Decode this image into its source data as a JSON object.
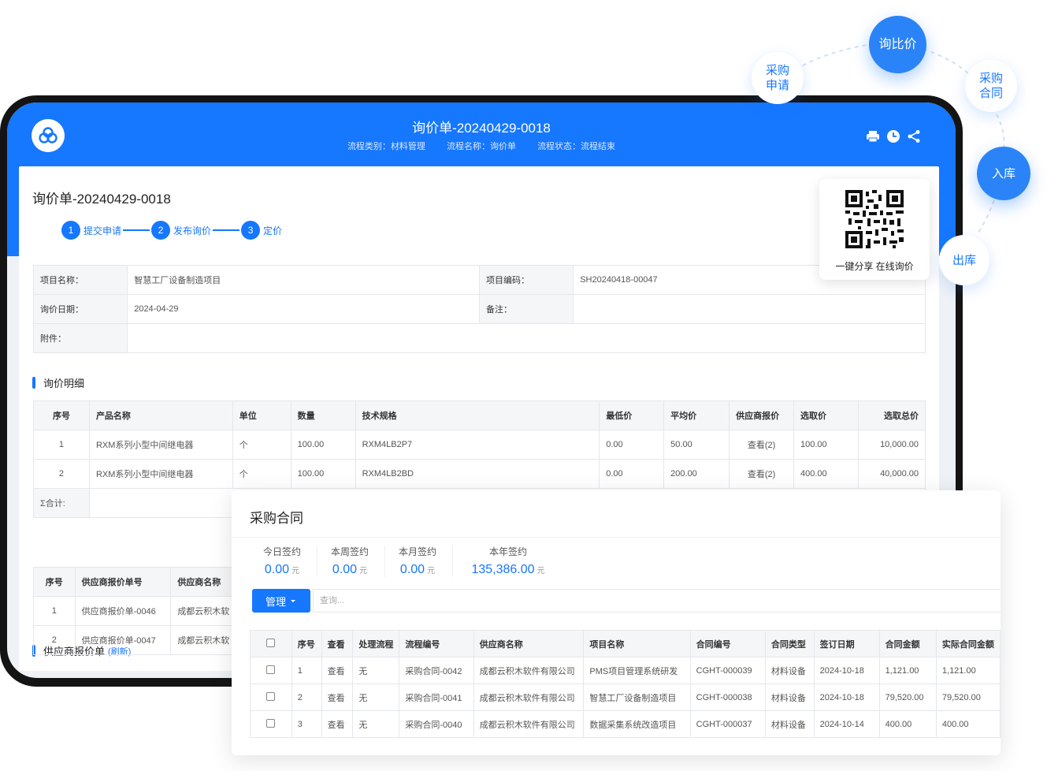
{
  "orbit": {
    "purchase_request": [
      "采购",
      "申请"
    ],
    "inquiry_compare": "询比价",
    "purchase_contract": [
      "采购",
      "合同"
    ],
    "stock_in": "入库",
    "stock_out": "出库"
  },
  "header": {
    "title": "询价单-20240429-0018",
    "meta": {
      "process_type": "流程类别：材料管理",
      "process_name": "流程名称：询价单",
      "process_status": "流程状态：流程结束"
    },
    "icons": [
      "print-icon",
      "clock-icon",
      "share-icon"
    ]
  },
  "document": {
    "title": "询价单-20240429-0018",
    "steps": [
      {
        "num": "1",
        "label": "提交申请"
      },
      {
        "num": "2",
        "label": "发布询价"
      },
      {
        "num": "3",
        "label": "定价"
      }
    ],
    "info": {
      "project_name_label": "项目名称：",
      "project_name_value": "智慧工厂设备制造项目",
      "project_code_label": "项目编码：",
      "project_code_value": "SH20240418-00047",
      "inquiry_date_label": "询价日期：",
      "inquiry_date_value": "2024-04-29",
      "remark_label": "备注：",
      "remark_value": "",
      "attachment_label": "附件：",
      "attachment_value": ""
    }
  },
  "qr": {
    "caption": "一键分享 在线询价"
  },
  "detail": {
    "title": "询价明细",
    "headers": [
      "序号",
      "产品名称",
      "单位",
      "数量",
      "技术规格",
      "最低价",
      "平均价",
      "供应商报价",
      "选取价",
      "选取总价"
    ],
    "rows": [
      [
        "1",
        "RXM系列小型中间继电器",
        "个",
        "100.00",
        "RXM4LB2P7",
        "0.00",
        "50.00",
        "查看(2)",
        "100.00",
        "10,000.00"
      ],
      [
        "2",
        "RXM系列小型中间继电器",
        "个",
        "100.00",
        "RXM4LB2BD",
        "0.00",
        "200.00",
        "查看(2)",
        "400.00",
        "40,000.00"
      ]
    ],
    "total_label": "Σ合计:"
  },
  "quotes": {
    "title": "供应商报价单",
    "refresh": "(刷新)",
    "headers": [
      "序号",
      "供应商报价单号",
      "供应商名称"
    ],
    "rows": [
      [
        "1",
        "供应商报价单-0046",
        "成都云积木软"
      ],
      [
        "2",
        "供应商报价单-0047",
        "成都云积木软"
      ]
    ]
  },
  "contract_panel": {
    "title": "采购合同",
    "stats": [
      {
        "label": "今日签约",
        "value": "0.00",
        "unit": "元"
      },
      {
        "label": "本周签约",
        "value": "0.00",
        "unit": "元"
      },
      {
        "label": "本月签约",
        "value": "0.00",
        "unit": "元"
      },
      {
        "label": "本年签约",
        "value": "135,386.00",
        "unit": "元"
      }
    ],
    "manage_label": "管理",
    "search_placeholder": "查询...",
    "headers": [
      "序号",
      "查看",
      "处理流程",
      "流程编号",
      "供应商名称",
      "项目名称",
      "合同编号",
      "合同类型",
      "签订日期",
      "合同金额",
      "实际合同金额"
    ],
    "rows": [
      [
        "1",
        "查看",
        "无",
        "采购合同-0042",
        "成都云积木软件有限公司",
        "PMS项目管理系统研发",
        "CGHT-000039",
        "材料设备",
        "2024-10-18",
        "1,121.00",
        "1,121.00"
      ],
      [
        "2",
        "查看",
        "无",
        "采购合同-0041",
        "成都云积木软件有限公司",
        "智慧工厂设备制造项目",
        "CGHT-000038",
        "材料设备",
        "2024-10-18",
        "79,520.00",
        "79,520.00"
      ],
      [
        "3",
        "查看",
        "无",
        "采购合同-0040",
        "成都云积木软件有限公司",
        "数据采集系统改造项目",
        "CGHT-000037",
        "材料设备",
        "2024-10-14",
        "400.00",
        "400.00"
      ]
    ]
  }
}
